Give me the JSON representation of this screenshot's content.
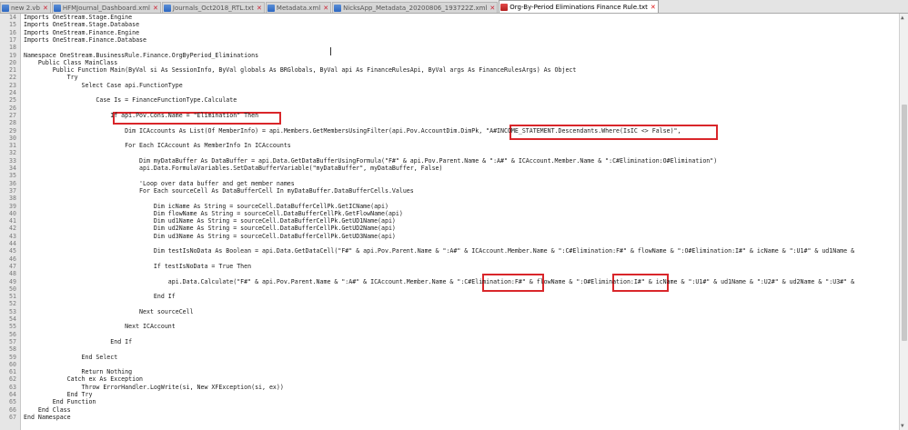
{
  "tabs": [
    {
      "label": "new 2.vb",
      "active": false
    },
    {
      "label": "HFMJournal_Dashboard.xml",
      "active": false
    },
    {
      "label": "Journals_Oct2018_RTL.txt",
      "active": false
    },
    {
      "label": "Metadata.xml",
      "active": false
    },
    {
      "label": "NicksApp_Metadata_20200806_193722Z.xml",
      "active": false
    },
    {
      "label": "Org-By-Period Eliminations Finance Rule.txt",
      "active": true
    }
  ],
  "editor": {
    "lines": [
      {
        "num": "14",
        "text": "Imports OneStream.Stage.Engine"
      },
      {
        "num": "15",
        "text": "Imports OneStream.Stage.Database"
      },
      {
        "num": "16",
        "text": "Imports OneStream.Finance.Engine"
      },
      {
        "num": "17",
        "text": "Imports OneStream.Finance.Database"
      },
      {
        "num": "18",
        "text": ""
      },
      {
        "num": "19",
        "text": "Namespace OneStream.BusinessRule.Finance.OrgByPeriod_Eliminations"
      },
      {
        "num": "20",
        "text": "    Public Class MainClass"
      },
      {
        "num": "21",
        "text": "        Public Function Main(ByVal si As SessionInfo, ByVal globals As BRGlobals, ByVal api As FinanceRulesApi, ByVal args As FinanceRulesArgs) As Object"
      },
      {
        "num": "22",
        "text": "            Try"
      },
      {
        "num": "23",
        "text": "                Select Case api.FunctionType"
      },
      {
        "num": "24",
        "text": ""
      },
      {
        "num": "25",
        "text": "                    Case Is = FinanceFunctionType.Calculate"
      },
      {
        "num": "26",
        "text": ""
      },
      {
        "num": "27",
        "text": "                        If api.Pov.Cons.Name = \"Elimination\" Then"
      },
      {
        "num": "28",
        "text": ""
      },
      {
        "num": "29",
        "text": "                            Dim ICAccounts As List(Of MemberInfo) = api.Members.GetMembersUsingFilter(api.Pov.AccountDim.DimPk, \"A#INCOME_STATEMENT.Descendants.Where(IsIC <> False)\","
      },
      {
        "num": "30",
        "text": ""
      },
      {
        "num": "31",
        "text": "                            For Each ICAccount As MemberInfo In ICAccounts"
      },
      {
        "num": "32",
        "text": ""
      },
      {
        "num": "33",
        "text": "                                Dim myDataBuffer As DataBuffer = api.Data.GetDataBufferUsingFormula(\"F#\" & api.Pov.Parent.Name & \":A#\" & ICAccount.Member.Name & \":C#Elimination:O#Elimination\")"
      },
      {
        "num": "34",
        "text": "                                api.Data.FormulaVariables.SetDataBufferVariable(\"myDataBuffer\", myDataBuffer, False)"
      },
      {
        "num": "35",
        "text": ""
      },
      {
        "num": "36",
        "text": "                                'Loop over data buffer and get member names"
      },
      {
        "num": "37",
        "text": "                                For Each sourceCell As DataBufferCell In myDataBuffer.DataBufferCells.Values"
      },
      {
        "num": "38",
        "text": ""
      },
      {
        "num": "39",
        "text": "                                    Dim icName As String = sourceCell.DataBufferCellPk.GetICName(api)"
      },
      {
        "num": "40",
        "text": "                                    Dim flowName As String = sourceCell.DataBufferCellPk.GetFlowName(api)"
      },
      {
        "num": "41",
        "text": "                                    Dim ud1Name As String = sourceCell.DataBufferCellPk.GetUD1Name(api)"
      },
      {
        "num": "42",
        "text": "                                    Dim ud2Name As String = sourceCell.DataBufferCellPk.GetUD2Name(api)"
      },
      {
        "num": "43",
        "text": "                                    Dim ud3Name As String = sourceCell.DataBufferCellPk.GetUD3Name(api)"
      },
      {
        "num": "44",
        "text": ""
      },
      {
        "num": "45",
        "text": "                                    Dim testIsNoData As Boolean = api.Data.GetDataCell(\"F#\" & api.Pov.Parent.Name & \":A#\" & ICAccount.Member.Name & \":C#Elimination:F#\" & flowName & \":O#Elimination:I#\" & icName & \":U1#\" & ud1Name &"
      },
      {
        "num": "46",
        "text": ""
      },
      {
        "num": "47",
        "text": "                                    If testIsNoData = True Then"
      },
      {
        "num": "48",
        "text": ""
      },
      {
        "num": "49",
        "text": "                                        api.Data.Calculate(\"F#\" & api.Pov.Parent.Name & \":A#\" & ICAccount.Member.Name & \":C#Elimination:F#\" & flowName & \":O#Elimination:I#\" & icName & \":U1#\" & ud1Name & \":U2#\" & ud2Name & \":U3#\" &"
      },
      {
        "num": "50",
        "text": ""
      },
      {
        "num": "51",
        "text": "                                    End If"
      },
      {
        "num": "52",
        "text": ""
      },
      {
        "num": "53",
        "text": "                                Next sourceCell"
      },
      {
        "num": "54",
        "text": ""
      },
      {
        "num": "55",
        "text": "                            Next ICAccount"
      },
      {
        "num": "56",
        "text": ""
      },
      {
        "num": "57",
        "text": "                        End If"
      },
      {
        "num": "58",
        "text": ""
      },
      {
        "num": "59",
        "text": "                End Select"
      },
      {
        "num": "60",
        "text": ""
      },
      {
        "num": "61",
        "text": "                Return Nothing"
      },
      {
        "num": "62",
        "text": "            Catch ex As Exception"
      },
      {
        "num": "63",
        "text": "                Throw ErrorHandler.LogWrite(si, New XFException(si, ex))"
      },
      {
        "num": "64",
        "text": "            End Try"
      },
      {
        "num": "65",
        "text": "        End Function"
      },
      {
        "num": "66",
        "text": "    End Class"
      },
      {
        "num": "67",
        "text": "End Namespace"
      }
    ]
  },
  "annotation_color": "#d9262a"
}
